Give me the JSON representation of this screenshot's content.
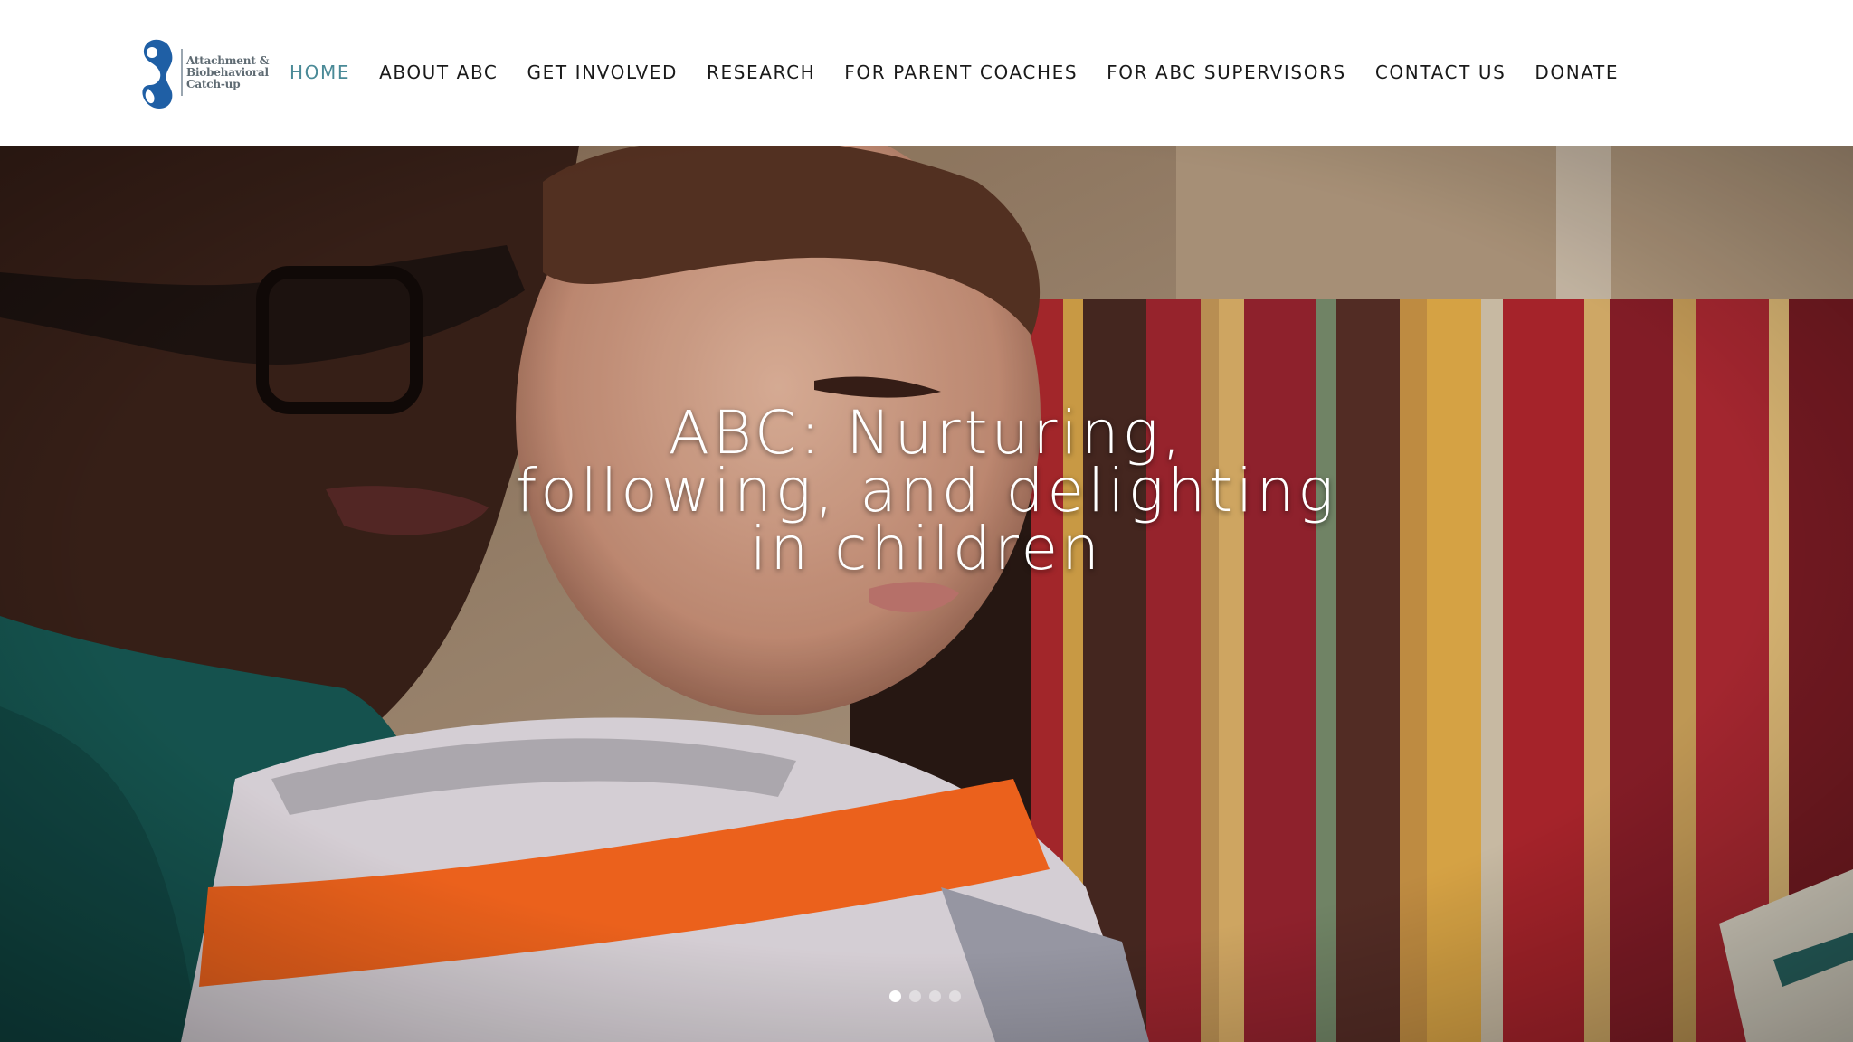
{
  "logo": {
    "line1": "Attachment &",
    "line2": "Biobehavioral",
    "line3": "Catch-up",
    "color": "#1f5fa5"
  },
  "nav": {
    "items": [
      {
        "label": "HOME",
        "active": true
      },
      {
        "label": "ABOUT ABC"
      },
      {
        "label": "GET INVOLVED"
      },
      {
        "label": "RESEARCH"
      },
      {
        "label": "FOR PARENT COACHES"
      },
      {
        "label": "FOR ABC SUPERVISORS"
      },
      {
        "label": "CONTACT US"
      },
      {
        "label": "DONATE"
      }
    ],
    "active_color": "#4a8a97"
  },
  "hero": {
    "title_line1": "ABC: Nurturing,",
    "title_line2": "following, and delighting",
    "title_line3": "in children",
    "slides": 4,
    "active_slide": 1
  }
}
